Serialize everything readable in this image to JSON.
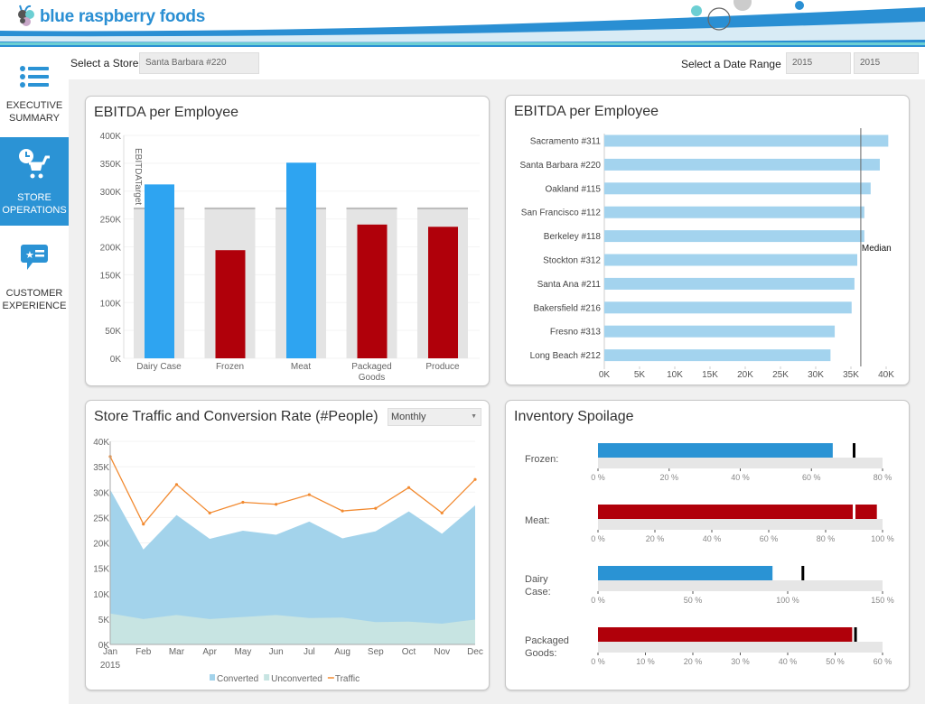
{
  "brand": {
    "name": "blue raspberry foods",
    "colors": {
      "primary": "#2b93d5",
      "teal": "#6ccfd3"
    }
  },
  "sidebar": {
    "items": [
      {
        "label_1": "EXECUTIVE",
        "label_2": "SUMMARY",
        "icon": "list-icon",
        "active": false
      },
      {
        "label_1": "STORE",
        "label_2": "OPERATIONS",
        "icon": "clock-cart-icon",
        "active": true
      },
      {
        "label_1": "CUSTOMER",
        "label_2": "EXPERIENCE",
        "icon": "chat-star-icon",
        "active": false
      }
    ]
  },
  "filters": {
    "store_label": "Select a Store",
    "store_value": "Santa Barbara #220",
    "date_label": "Select a Date Range",
    "date_from": "2015",
    "date_to": "2015"
  },
  "chart_data": [
    {
      "type": "bar",
      "title": "EBITDA per Employee",
      "categories": [
        "Dairy Case",
        "Frozen",
        "Meat",
        "Packaged Goods",
        "Produce"
      ],
      "values": [
        312000,
        194000,
        351000,
        240000,
        236000
      ],
      "target": 269000,
      "target_label": "EBITDATarget",
      "ylim": [
        0,
        400000
      ],
      "yticks": [
        "0K",
        "50K",
        "100K",
        "150K",
        "200K",
        "250K",
        "300K",
        "350K",
        "400K"
      ],
      "colors": {
        "above": "#2ea4f1",
        "below": "#b0000a",
        "target_band": "#e4e4e4"
      }
    },
    {
      "type": "bar",
      "orientation": "horizontal",
      "title": "EBITDA per Employee",
      "categories": [
        "Sacramento #311",
        "Santa Barbara #220",
        "Oakland #115",
        "San Francisco #112",
        "Berkeley #118",
        "Stockton #312",
        "Santa Ana #211",
        "Bakersfield #216",
        "Fresno #313",
        "Long Beach #212"
      ],
      "values": [
        40300,
        39100,
        37800,
        36900,
        36900,
        35900,
        35500,
        35100,
        32700,
        32100
      ],
      "median": 36400,
      "median_label": "Median",
      "xlim": [
        0,
        40000
      ],
      "xticks": [
        "0K",
        "5K",
        "10K",
        "15K",
        "20K",
        "25K",
        "30K",
        "35K",
        "40K"
      ],
      "color": "#a3d3ee"
    },
    {
      "type": "area",
      "stacked": true,
      "title": "Store Traffic and Conversion Rate (#People)",
      "granularity": "Monthly",
      "categories": [
        "Jan",
        "Feb",
        "Mar",
        "Apr",
        "May",
        "Jun",
        "Jul",
        "Aug",
        "Sep",
        "Oct",
        "Nov",
        "Dec"
      ],
      "year_label": "2015",
      "series": [
        {
          "name": "Unconverted",
          "type": "area",
          "values": [
            6100,
            5000,
            5800,
            5000,
            5400,
            5800,
            5200,
            5300,
            4400,
            4500,
            4100,
            4900
          ],
          "color": "#c7e4e2"
        },
        {
          "name": "Converted",
          "type": "area",
          "values": [
            24400,
            13700,
            19700,
            15800,
            17000,
            15800,
            19000,
            15600,
            17900,
            21700,
            17700,
            22500
          ],
          "color": "#a3d3eb"
        },
        {
          "name": "Traffic",
          "type": "line",
          "values": [
            37000,
            23700,
            31500,
            25900,
            28000,
            27600,
            29500,
            26300,
            26800,
            30900,
            25900,
            32500
          ],
          "color": "#f28a30"
        }
      ],
      "legend_order": [
        "Converted",
        "Unconverted",
        "Traffic"
      ],
      "ylim": [
        0,
        40000
      ],
      "yticks": [
        "0K",
        "5K",
        "10K",
        "15K",
        "20K",
        "25K",
        "30K",
        "35K",
        "40K"
      ],
      "legend": "bottom"
    },
    {
      "type": "bullet",
      "title": "Inventory Spoilage",
      "rows": [
        {
          "label": "Frozen:",
          "value": 66,
          "target": 72,
          "max": 80,
          "ticks": [
            "0 %",
            "20 %",
            "40 %",
            "60 %",
            "80 %"
          ],
          "color": "#2a93d4"
        },
        {
          "label": "Meat:",
          "value": 98,
          "target": 90,
          "max": 100,
          "ticks": [
            "0 %",
            "20 %",
            "40 %",
            "60 %",
            "80 %",
            "100 %"
          ],
          "color": "#b0000a"
        },
        {
          "label": "Dairy Case:",
          "value": 92,
          "target": 108,
          "max": 150,
          "ticks": [
            "0 %",
            "50 %",
            "100 %",
            "150 %"
          ],
          "color": "#2a93d4"
        },
        {
          "label": "Packaged Goods:",
          "value": 53.6,
          "target": 54.3,
          "max": 60,
          "ticks": [
            "0 %",
            "10 %",
            "20 %",
            "30 %",
            "40 %",
            "50 %",
            "60 %"
          ],
          "color": "#b0000a"
        }
      ]
    }
  ]
}
